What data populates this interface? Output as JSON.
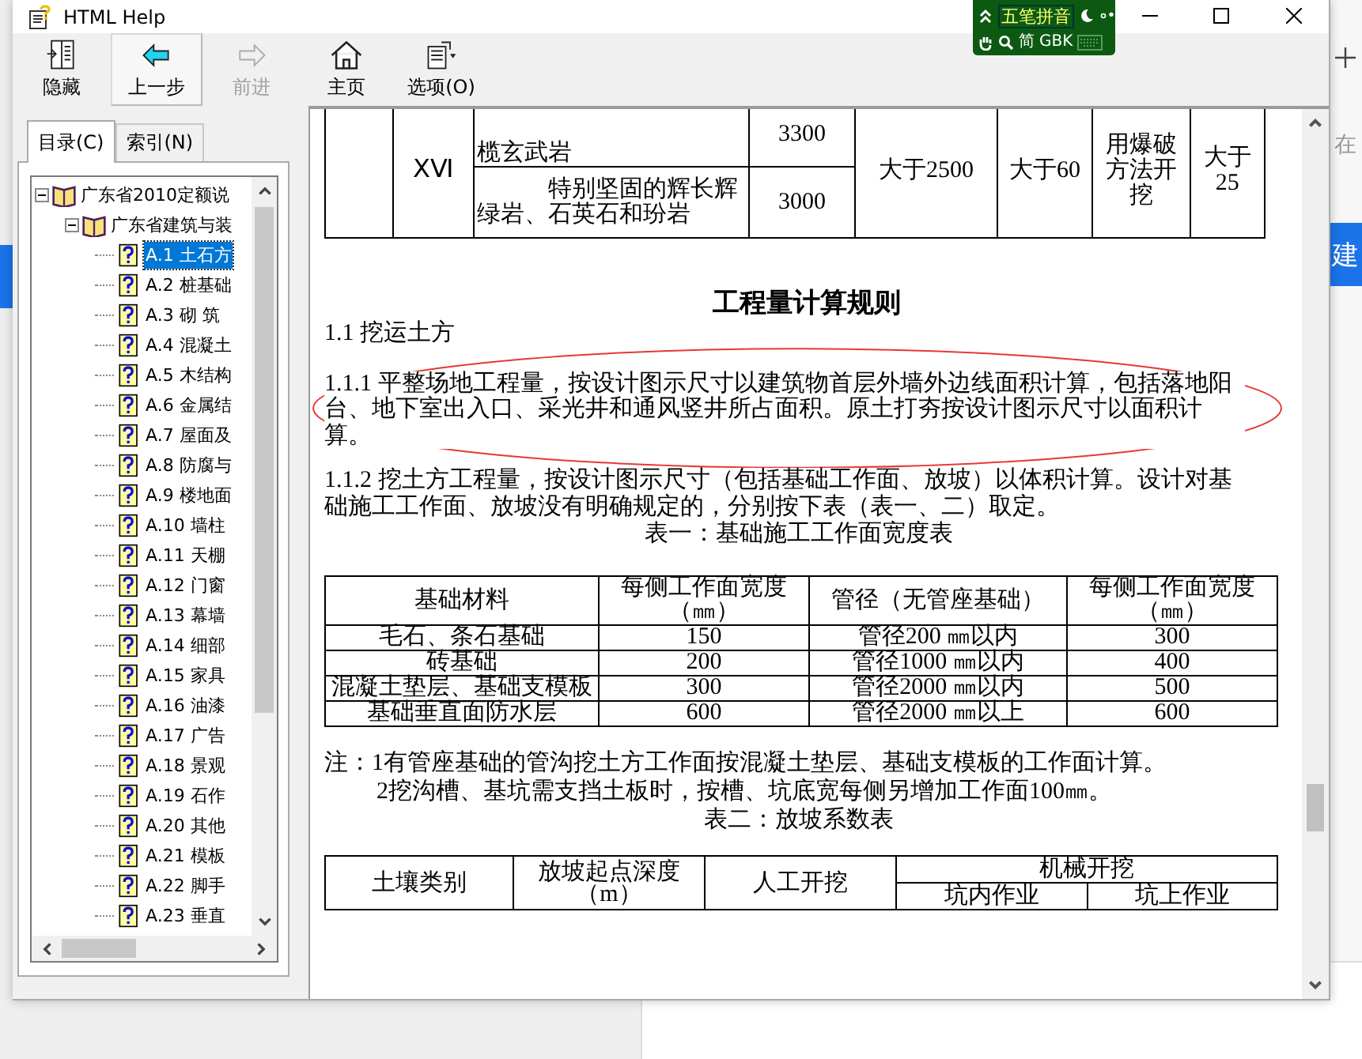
{
  "window": {
    "title": "HTML Help"
  },
  "ime_bar": {
    "mode": "五笔拼音",
    "charset": "简",
    "encoding": "GBK"
  },
  "toolbar": [
    {
      "kind": "hide",
      "label": "隐藏",
      "disabled": false,
      "pressed": false
    },
    {
      "kind": "back",
      "label": "上一步",
      "disabled": false,
      "pressed": true
    },
    {
      "kind": "forward",
      "label": "前进",
      "disabled": true,
      "pressed": false
    },
    {
      "kind": "home",
      "label": "主页",
      "disabled": false,
      "pressed": false
    },
    {
      "kind": "options",
      "label": "选项(O)",
      "disabled": false,
      "pressed": false
    }
  ],
  "nav_tabs": [
    {
      "label": "目录(C)",
      "selected": true
    },
    {
      "label": "索引(N)",
      "selected": false
    }
  ],
  "tree": [
    {
      "label": "广东省2010定额说",
      "expanded": true,
      "selected": false,
      "children": [
        {
          "label": "广东省建筑与装",
          "expanded": true,
          "selected": false,
          "children": [
            {
              "label": "A.1  土石方",
              "selected": true
            },
            {
              "label": "A.2  桩基础",
              "selected": false
            },
            {
              "label": "A.3  砌  筑",
              "selected": false
            },
            {
              "label": "A.4  混凝土",
              "selected": false
            },
            {
              "label": "A.5  木结构",
              "selected": false
            },
            {
              "label": "A.6  金属结",
              "selected": false
            },
            {
              "label": "A.7 屋面及",
              "selected": false
            },
            {
              "label": "A.8  防腐与",
              "selected": false
            },
            {
              "label": "A.9  楼地面",
              "selected": false
            },
            {
              "label": "A.10  墙柱",
              "selected": false
            },
            {
              "label": "A.11  天棚",
              "selected": false
            },
            {
              "label": "A.12  门窗",
              "selected": false
            },
            {
              "label": "A.13  幕墙",
              "selected": false
            },
            {
              "label": "A.14  细部",
              "selected": false
            },
            {
              "label": "A.15  家具",
              "selected": false
            },
            {
              "label": "A.16  油漆",
              "selected": false
            },
            {
              "label": "A.17  广告",
              "selected": false
            },
            {
              "label": "A.18 景观",
              "selected": false
            },
            {
              "label": "A.19 石作",
              "selected": false
            },
            {
              "label": "A.20  其他",
              "selected": false
            },
            {
              "label": "A.21  模板",
              "selected": false
            },
            {
              "label": "A.22  脚手",
              "selected": false
            },
            {
              "label": "A.23  垂直",
              "selected": false
            }
          ]
        }
      ]
    }
  ],
  "top_table": {
    "class": "ⅩⅥ",
    "rocks": [
      {
        "name": "榄玄武岩",
        "strength": "3300"
      },
      {
        "name": "特别坚固的辉长辉绿岩、石英石和玢岩",
        "strength": "3000"
      }
    ],
    "column_5": "大于2500",
    "column_6": "大于60",
    "column_7": "用爆破方法开挖",
    "column_8": "大于25"
  },
  "heading": "工程量计算规则",
  "paragraphs": [
    {
      "text": "1.1  挖运土方",
      "highlighted": false
    },
    {
      "text": "1.1.1  平整场地工程量，按设计图示尺寸以建筑物首层外墙外边线面积计算，包括落地阳台、地下室出入口、采光井和通风竖井所占面积。原土打夯按设计图示尺寸以面积计算。",
      "highlighted": true
    },
    {
      "text": "1.1.2  挖土方工程量，按设计图示尺寸（包括基础工作面、放坡）以体积计算。设计对基础施工工作面、放坡没有明确规定的，分别按下表（表一、二）取定。",
      "highlighted": false
    }
  ],
  "table1": {
    "caption": "表一：基础施工工作面宽度表",
    "columns": [
      "基础材料",
      "每侧工作面宽度（㎜）",
      "管径（无管座基础）",
      "每侧工作面宽度（㎜）"
    ],
    "rows": [
      [
        "毛石、条石基础",
        "150",
        "管径200 ㎜以内",
        "300"
      ],
      [
        "砖基础",
        "200",
        "管径1000 ㎜以内",
        "400"
      ],
      [
        "混凝土垫层、基础支模板",
        "300",
        "管径2000 ㎜以内",
        "500"
      ],
      [
        "基础垂直面防水层",
        "600",
        "管径2000 ㎜以上",
        "600"
      ]
    ]
  },
  "notes": [
    "注：1有管座基础的管沟挖土方工作面按混凝土垫层、基础支模板的工作面计算。",
    "2挖沟槽、基坑需支挡土板时，按槽、坑底宽每侧另增加工作面100㎜。"
  ],
  "table2": {
    "caption": "表二：放坡系数表",
    "columns": [
      "土壤类别",
      "放坡起点深度（m）",
      "人工开挖",
      "机械开挖"
    ],
    "subcolumns": [
      "坑内作业",
      "坑上作业"
    ]
  },
  "background_app": {
    "texts": [
      "在"
    ],
    "button": "建"
  }
}
